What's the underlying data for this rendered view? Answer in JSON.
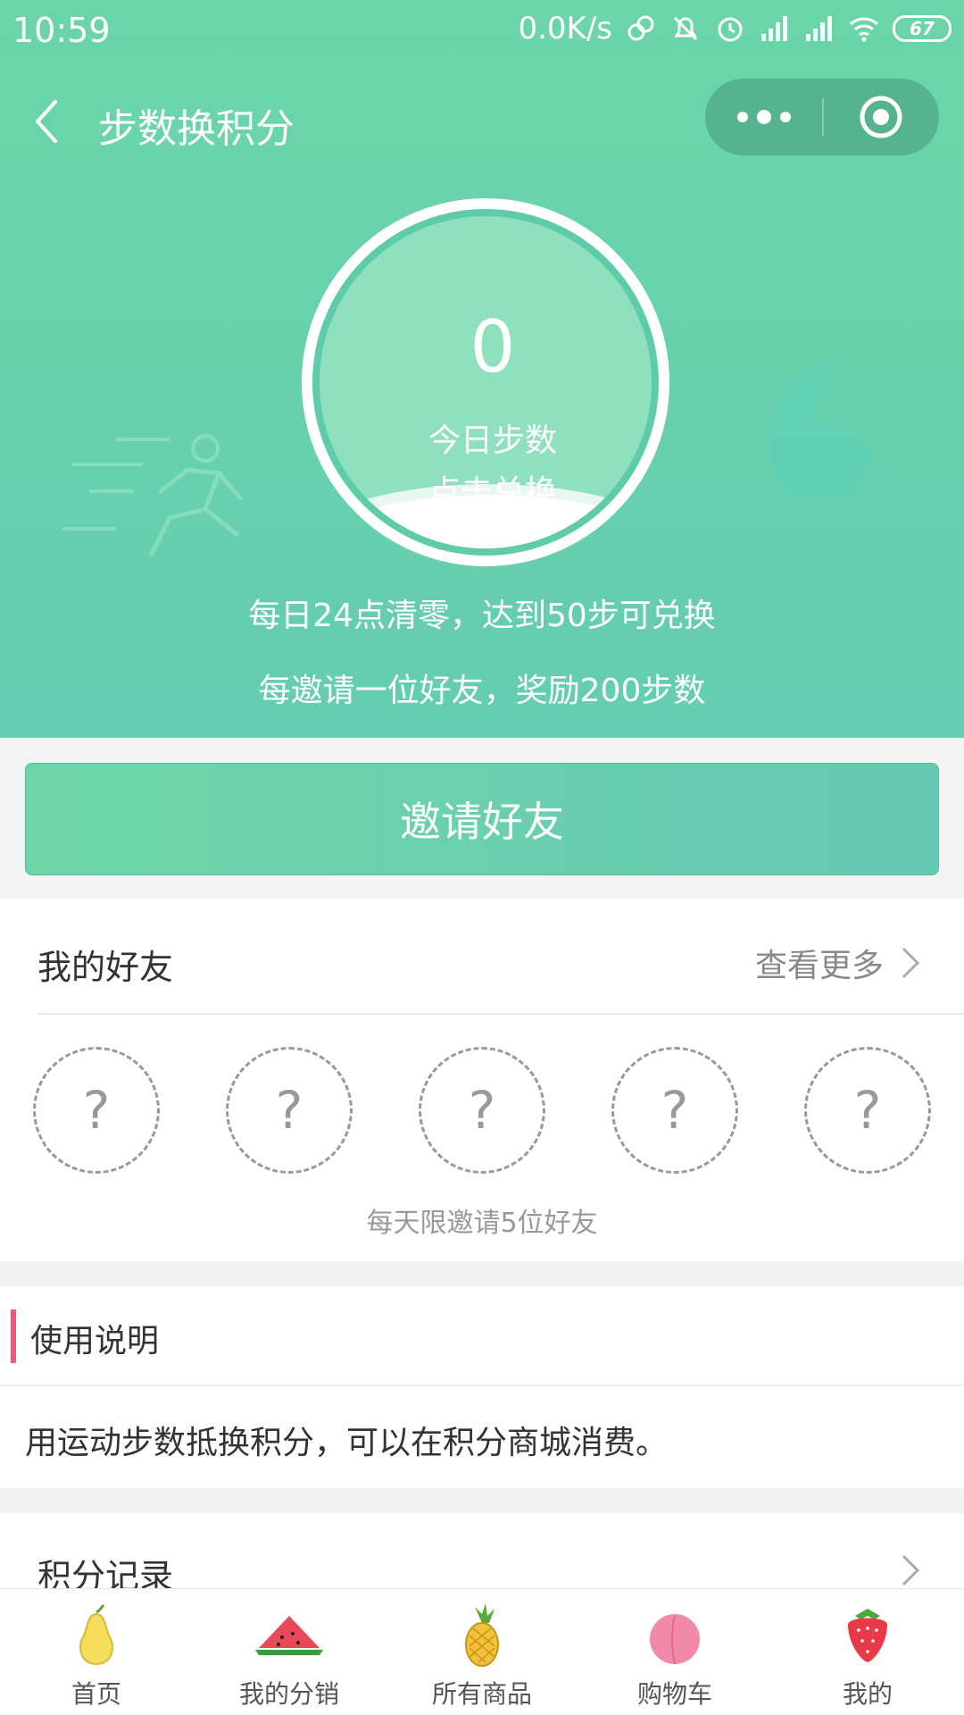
{
  "status_bar": {
    "time": "10:59",
    "network_speed": "0.0K/s",
    "battery": "67",
    "icons": [
      "link-icon",
      "bell-off-icon",
      "alarm-icon",
      "signal-icon",
      "signal-icon",
      "wifi-icon",
      "battery-icon"
    ]
  },
  "nav": {
    "title": "步数换积分",
    "back_icon": "chevron-left-icon",
    "more_icon": "more-dots-icon",
    "close_icon": "target-close-icon"
  },
  "steps": {
    "value": "0",
    "label": "今日步数",
    "action": "点击兑换"
  },
  "rules": {
    "reset": "每日24点清零，达到50步可兑换",
    "invite_reward": "每邀请一位好友，奖励200步数"
  },
  "invite_button": "邀请好友",
  "friends": {
    "title": "我的好友",
    "see_more": "查看更多",
    "slots": [
      "?",
      "?",
      "?",
      "?",
      "?"
    ],
    "limit_note": "每天限邀请5位好友"
  },
  "usage": {
    "title": "使用说明",
    "description": "用运动步数抵换积分，可以在积分商城消费。"
  },
  "records": {
    "title": "积分记录"
  },
  "tabbar": {
    "items": [
      {
        "label": "首页",
        "icon": "pear-icon"
      },
      {
        "label": "我的分销",
        "icon": "watermelon-icon"
      },
      {
        "label": "所有商品",
        "icon": "pineapple-icon"
      },
      {
        "label": "购物车",
        "icon": "peach-icon"
      },
      {
        "label": "我的",
        "icon": "strawberry-icon"
      }
    ]
  },
  "colors": {
    "hero": "#6bd5a9",
    "accent_bar": "#e65a7a"
  }
}
